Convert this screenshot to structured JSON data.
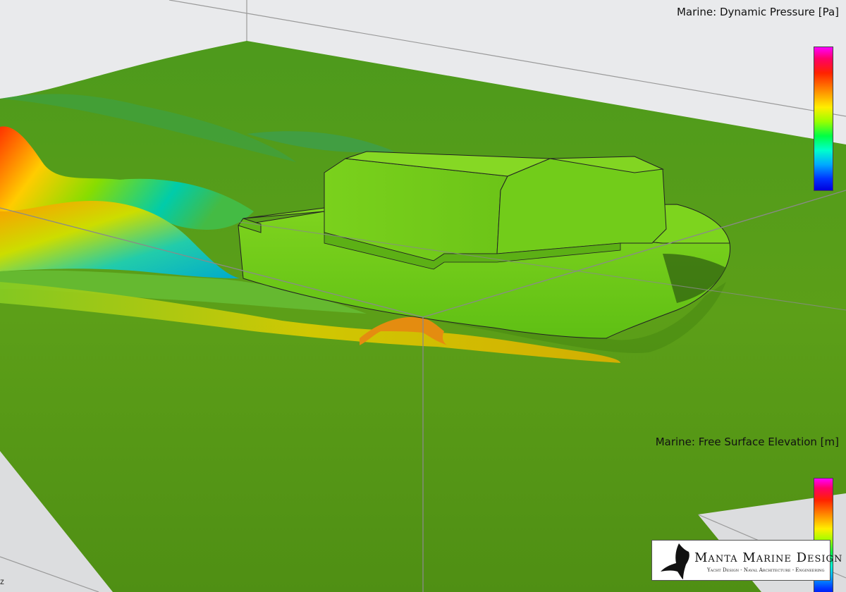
{
  "legends": {
    "pressure": {
      "title": "Marine: Dynamic Pressure [Pa]"
    },
    "elevation": {
      "title": "Marine: Free Surface Elevation [m]"
    }
  },
  "logo": {
    "name": "Manta Marine Design",
    "tagline": "Yacht Design - Naval Architecture - Engineering"
  },
  "axis": {
    "label": "z"
  },
  "colors": {
    "water": "#5a9a1a",
    "hull": "#6fcc1a",
    "background": "#e9eaec"
  }
}
